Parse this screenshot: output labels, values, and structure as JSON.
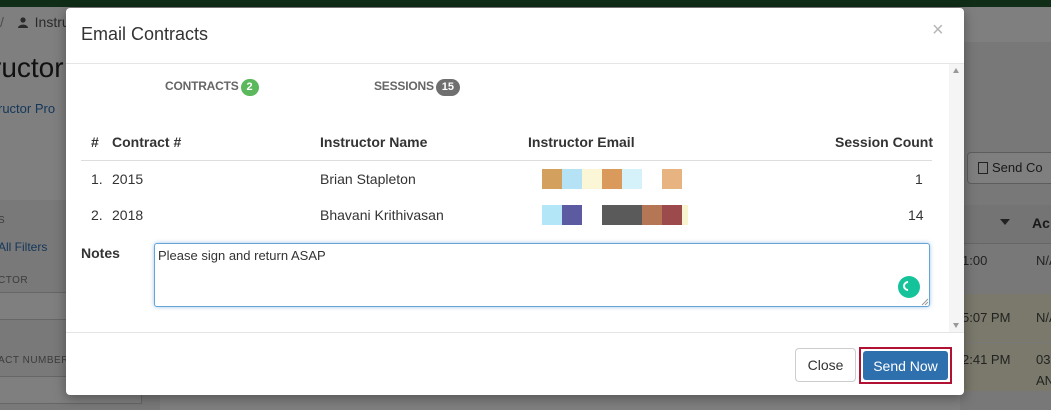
{
  "background": {
    "breadcrumb_sep": "/",
    "breadcrumb_item": "Instru",
    "page_title": "ructor",
    "profile_link": "ructor Pro",
    "send_button": "Send Co",
    "filters_label": "S",
    "all_filters": "All Filters",
    "instructor_label": "CTOR",
    "contract_number_label": "ACT NUMBER",
    "column_header": "Ac",
    "cells": [
      "1:00",
      "N/A",
      "5:07 PM",
      "N/A",
      "2:41 PM",
      "03",
      "AN"
    ]
  },
  "modal": {
    "title": "Email Contracts",
    "close_glyph": "×",
    "tabs": [
      {
        "label": "CONTRACTS",
        "count": "2",
        "badge_color": "#5cb85c"
      },
      {
        "label": "SESSIONS",
        "count": "15",
        "badge_color": "#6f6f6f"
      }
    ],
    "table": {
      "headers": [
        "#",
        "Contract #",
        "Instructor Name",
        "Instructor Email",
        "Session Count"
      ],
      "rows": [
        {
          "num": "1.",
          "contract": "2015",
          "name": "Brian Stapleton",
          "count": "1"
        },
        {
          "num": "2.",
          "contract": "2018",
          "name": "Bhavani Krithivasan",
          "count": "14"
        }
      ]
    },
    "notes": {
      "label": "Notes",
      "value": "Please sign and return ASAP"
    },
    "footer": {
      "close_label": "Close",
      "send_label": "Send Now"
    }
  },
  "colors": {
    "primary_button": "#2e6fad",
    "highlight_border": "#b11233",
    "grammarly": "#15c39a"
  }
}
